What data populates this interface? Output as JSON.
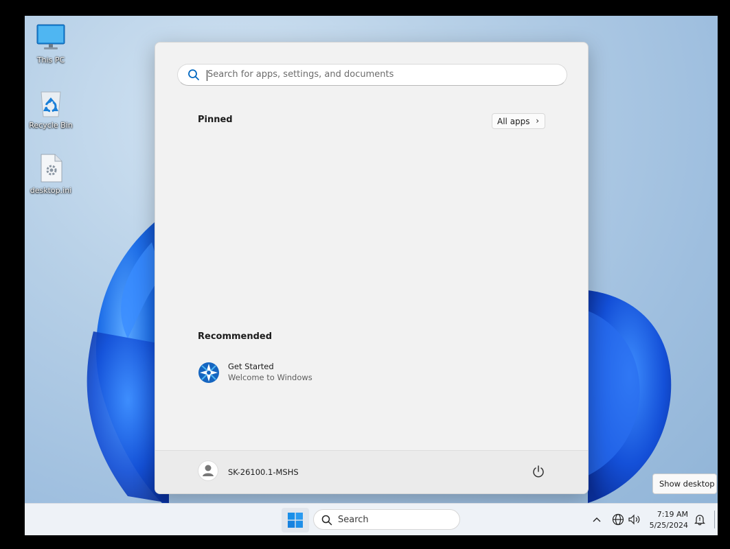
{
  "desktop": {
    "icons": [
      {
        "label": "This PC"
      },
      {
        "label": "Recycle Bin"
      },
      {
        "label": "desktop.ini"
      }
    ]
  },
  "start_menu": {
    "search_placeholder": "Search for apps, settings, and documents",
    "pinned_title": "Pinned",
    "all_apps_label": "All apps",
    "recommended_title": "Recommended",
    "recommended_items": [
      {
        "title": "Get Started",
        "subtitle": "Welcome to Windows"
      }
    ],
    "user_name": "SK-26100.1-MSHS"
  },
  "taskbar": {
    "search_label": "Search",
    "time": "7:19 AM",
    "date": "5/25/2024"
  },
  "tooltip": {
    "show_desktop": "Show desktop"
  },
  "colors": {
    "accent": "#0067c0",
    "start_bg": "#f2f2f2",
    "taskbar_bg": "#eef2f7"
  }
}
